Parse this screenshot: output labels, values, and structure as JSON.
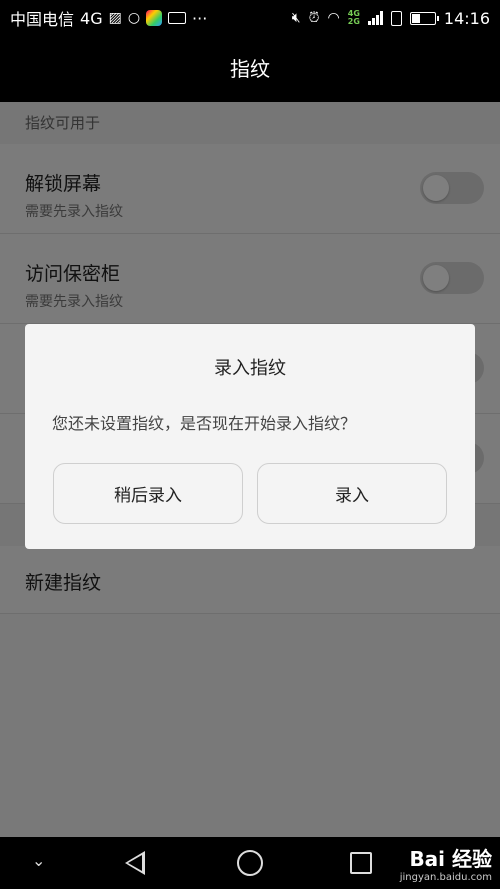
{
  "status_bar": {
    "carrier": "中国电信",
    "network_type": "4G",
    "net_top": "4G",
    "net_bottom": "2G",
    "time": "14:16",
    "more": "···"
  },
  "header": {
    "title": "指纹"
  },
  "settings": {
    "section_title": "指纹可用于",
    "items": [
      {
        "title": "解锁屏幕",
        "subtitle": "需要先录入指纹",
        "enabled": false
      },
      {
        "title": "访问保密柜",
        "subtitle": "需要先录入指纹",
        "enabled": false
      }
    ],
    "new_fingerprint": "新建指纹"
  },
  "dialog": {
    "title": "录入指纹",
    "message": "您还未设置指纹，是否现在开始录入指纹？",
    "later_label": "稍后录入",
    "enroll_label": "录入"
  },
  "watermark": {
    "brand": "Bai  经验",
    "url": "jingyan.baidu.com"
  }
}
